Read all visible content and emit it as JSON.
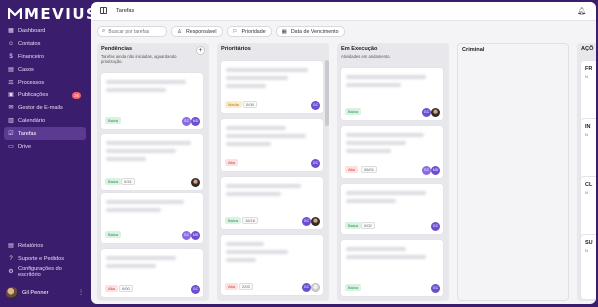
{
  "brand": {
    "name": "MEVIUS"
  },
  "sidebar": {
    "items": [
      {
        "label": "Dashboard",
        "icon": "dashboard-icon"
      },
      {
        "label": "Contatos",
        "icon": "contacts-icon"
      },
      {
        "label": "Financeiro",
        "icon": "finance-icon"
      },
      {
        "label": "Casos",
        "icon": "cases-icon"
      },
      {
        "label": "Processos",
        "icon": "process-icon"
      },
      {
        "label": "Publicações",
        "icon": "publications-icon",
        "badge": "26"
      },
      {
        "label": "Gestor de E-mails",
        "icon": "email-icon"
      },
      {
        "label": "Calendário",
        "icon": "calendar-icon"
      },
      {
        "label": "Tarefas",
        "icon": "tasks-icon",
        "active": true
      },
      {
        "label": "Drive",
        "icon": "drive-icon"
      }
    ],
    "bottom_items": [
      {
        "label": "Relatórios",
        "icon": "reports-icon"
      },
      {
        "label": "Suporte e Pedidos",
        "icon": "support-icon"
      },
      {
        "label": "Configurações do escritório",
        "icon": "settings-icon"
      }
    ],
    "user": {
      "name": "Gil Penner"
    }
  },
  "header": {
    "title": "Tarefas"
  },
  "filters": {
    "search_placeholder": "Buscar por tarefas",
    "responsavel": "Responsável",
    "prioridade": "Prioridade",
    "vencimento": "Data de Vencimento"
  },
  "columns": [
    {
      "title": "Pendências",
      "subtitle": "Tarefas ainda não iniciadas, aguardando priorização.",
      "cards": [
        {
          "priority": "Baixa",
          "count": "",
          "avatars": [
            "GC",
            "MD"
          ]
        },
        {
          "priority": "Baixa",
          "count": "0/31",
          "avatars": [
            "photo"
          ]
        },
        {
          "priority": "Baixa",
          "count": "",
          "avatars": [
            "GC",
            "MD"
          ]
        },
        {
          "priority": "Alta",
          "count": "0/00",
          "avatars": [
            "GC"
          ]
        }
      ]
    },
    {
      "title": "Prioritários",
      "subtitle": "",
      "cards": [
        {
          "priority": "Média",
          "count": "0/08",
          "avatars": [
            "GC"
          ]
        },
        {
          "priority": "Alta",
          "count": "",
          "avatars": [
            "GC"
          ]
        },
        {
          "priority": "Baixa",
          "count": "16/16",
          "avatars": [
            "GC",
            "photo"
          ]
        },
        {
          "priority": "Alta",
          "count": "2/03",
          "avatars": [
            "GC",
            "photo2"
          ]
        }
      ]
    },
    {
      "title": "Em Execução",
      "subtitle": "Atividades em andamento.",
      "cards": [
        {
          "priority": "Baixa",
          "count": "",
          "avatars": [
            "GC",
            "photo"
          ]
        },
        {
          "priority": "Alta",
          "count": "06/01",
          "avatars": [
            "GC",
            "MD"
          ]
        },
        {
          "priority": "Baixa",
          "count": "0/02",
          "avatars": [
            "GC"
          ]
        },
        {
          "priority": "Baixa",
          "count": "",
          "avatars": [
            "GC"
          ]
        }
      ]
    },
    {
      "title": "Criminal",
      "subtitle": ""
    },
    {
      "title": "AÇÕ",
      "cards": [
        {
          "title": "FR"
        },
        {
          "title": "IN"
        },
        {
          "title": "CL"
        },
        {
          "title": "SU"
        }
      ]
    }
  ]
}
